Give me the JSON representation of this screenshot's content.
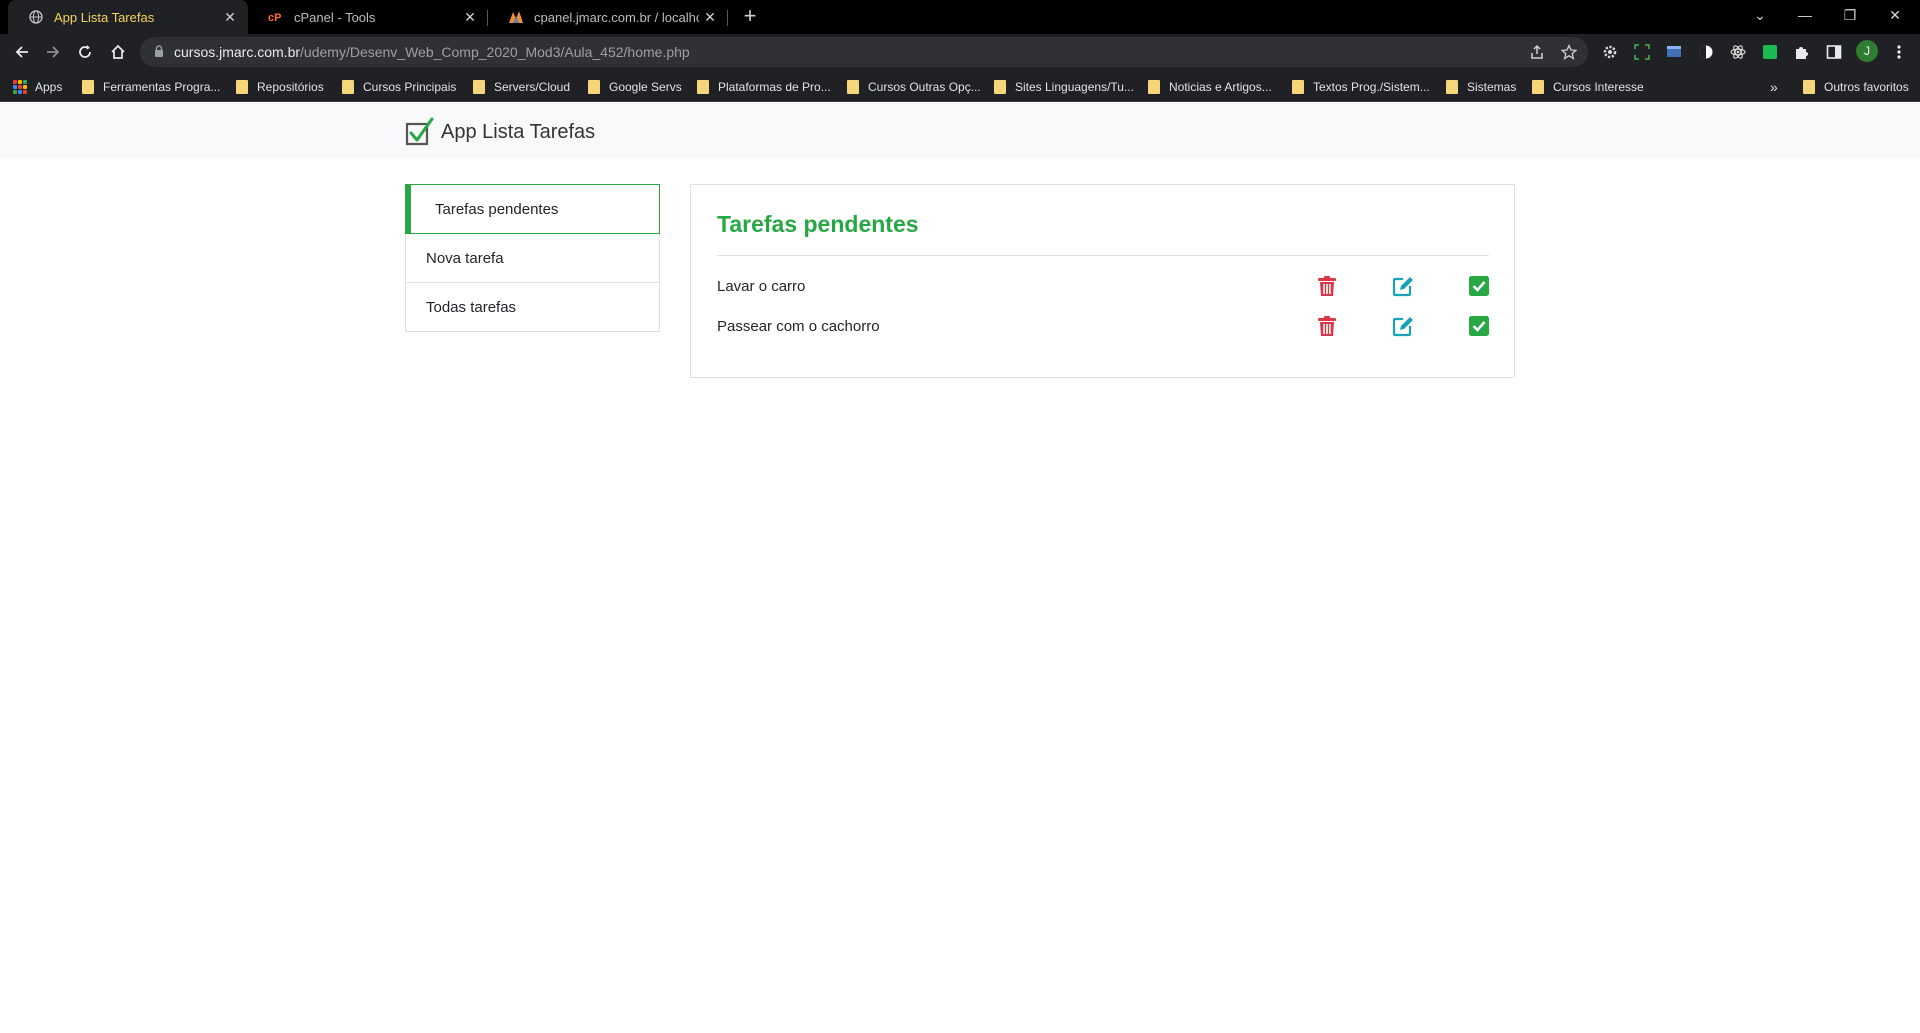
{
  "browser": {
    "tabs": [
      {
        "title": "App Lista Tarefas",
        "active": true,
        "favicon": "globe-icon"
      },
      {
        "title": "cPanel - Tools",
        "active": false,
        "favicon": "cpanel-icon"
      },
      {
        "title": "cpanel.jmarc.com.br / localhost /",
        "active": false,
        "favicon": "phpmyadmin-icon"
      }
    ],
    "url_host": "cursos.jmarc.com.br",
    "url_path": "/udemy/Desenv_Web_Comp_2020_Mod3/Aula_452/home.php",
    "profile_initial": "J",
    "bookmarks": [
      "Apps",
      "Ferramentas Progra...",
      "Repositórios",
      "Cursos Principais",
      "Servers/Cloud",
      "Google Servs",
      "Plataformas de Pro...",
      "Cursos Outras Opç...",
      "Sites Linguagens/Tu...",
      "Noticias e Artigos...",
      "Textos Prog./Sistem...",
      "Sistemas",
      "Cursos Interesse"
    ],
    "bookmarks_overflow": "»",
    "other_bookmarks": "Outros favoritos"
  },
  "app": {
    "brand": "App Lista Tarefas",
    "menu": [
      {
        "label": "Tarefas pendentes",
        "active": true
      },
      {
        "label": "Nova tarefa",
        "active": false
      },
      {
        "label": "Todas tarefas",
        "active": false
      }
    ],
    "card_title": "Tarefas pendentes",
    "tasks": [
      {
        "text": "Lavar o carro"
      },
      {
        "text": "Passear com o cachorro"
      }
    ]
  },
  "colors": {
    "accent_green": "#28a745",
    "delete_red": "#dc3545",
    "edit_blue": "#17a2b8"
  }
}
